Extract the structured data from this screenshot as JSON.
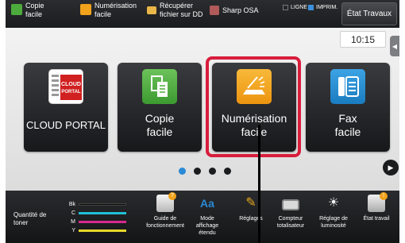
{
  "topbar": {
    "copie_facile": "Copie\nfacile",
    "numerisation_facile": "Numérisation\nfacile",
    "recuperer": "Récupérer\nfichier sur DD",
    "sharp_osa": "Sharp OSA",
    "ligne": "LIGNE",
    "imprim": "IMPRIM.",
    "etat_travaux": "État Travaux"
  },
  "clock": "10:15",
  "tiles": [
    {
      "label": "CLOUD PORTAL",
      "icon_text": "CLOUD\nPORTAL"
    },
    {
      "label": "Copie\nfacile"
    },
    {
      "label": "Numérisation\nfacile"
    },
    {
      "label": "Fax\nfacile"
    }
  ],
  "toner": {
    "title": "Quantité de\ntoner",
    "rows": [
      {
        "label": "Bk",
        "color": "#111111"
      },
      {
        "label": "C",
        "color": "#1ec0d8"
      },
      {
        "label": "M",
        "color": "#d62a8f"
      },
      {
        "label": "Y",
        "color": "#e8d82a"
      }
    ]
  },
  "bottom_items": [
    {
      "label": "Guide de\nfonctionnement",
      "icon": "guide-icon"
    },
    {
      "label": "Mode\naffichage\nétendu",
      "icon": "display-mode-icon"
    },
    {
      "label": "Réglages",
      "icon": "settings-icon"
    },
    {
      "label": "Compteur\ntotalisateur",
      "icon": "counter-icon"
    },
    {
      "label": "Réglage de\nluminosité",
      "icon": "brightness-icon"
    },
    {
      "label": "État travail",
      "icon": "job-status-icon"
    }
  ],
  "colors": {
    "highlight": "#d81d3c",
    "page_dot_active": "#2a8ad6",
    "copy_green": "#4cab3c",
    "scan_orange": "#f2a21b",
    "fax_blue": "#1f8fd3"
  }
}
